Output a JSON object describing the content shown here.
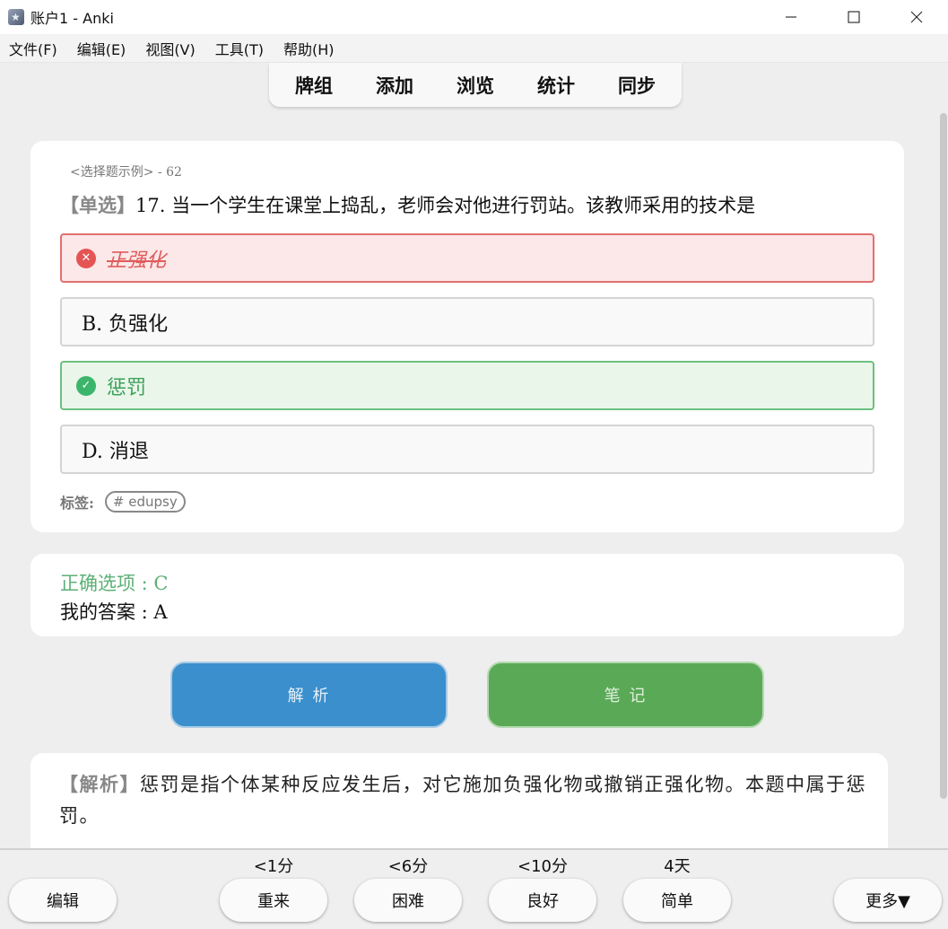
{
  "window": {
    "title": "账户1 - Anki",
    "minimize": "—",
    "maximize": "☐",
    "close": "✕"
  },
  "menu": [
    "文件(F)",
    "编辑(E)",
    "视图(V)",
    "工具(T)",
    "帮助(H)"
  ],
  "toptabs": [
    "牌组",
    "添加",
    "浏览",
    "统计",
    "同步"
  ],
  "card": {
    "deck_label": "<选择题示例> - 62",
    "question_type": "【单选】",
    "question_text": "17. 当一个学生在课堂上捣乱，老师会对他进行罚站。该教师采用的技术是",
    "options": [
      {
        "text": "正强化",
        "state": "wrong"
      },
      {
        "text": "B. 负强化",
        "state": "plain"
      },
      {
        "text": "惩罚",
        "state": "correct"
      },
      {
        "text": "D. 消退",
        "state": "plain"
      }
    ],
    "tags_label": "标签:",
    "tag": "# edupsy"
  },
  "answer": {
    "correct": "正确选项 : C",
    "mine": "我的答案 : A"
  },
  "buttons": {
    "analysis": "解 析",
    "note": "笔 记"
  },
  "explanation": {
    "head": "【解析】",
    "body": "惩罚是指个体某种反应发生后，对它施加负强化物或撤销正强化物。本题中属于惩罚。"
  },
  "bottom": {
    "edit": "编辑",
    "more": "更多▼",
    "answers": [
      {
        "label": "重来",
        "time": "<1分"
      },
      {
        "label": "困难",
        "time": "<6分"
      },
      {
        "label": "良好",
        "time": "<10分"
      },
      {
        "label": "简单",
        "time": "4天"
      }
    ]
  },
  "colors": {
    "wrong": "#e45454",
    "correct": "#3bb56a",
    "analysis_btn": "#3a8fcc",
    "note_btn": "#5aa957"
  }
}
